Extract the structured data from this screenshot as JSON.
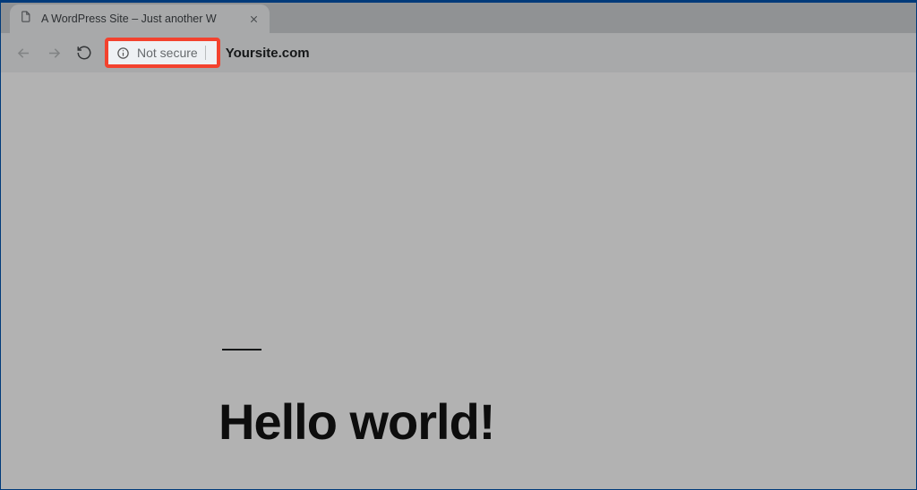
{
  "tab": {
    "title": "A WordPress Site – Just another W"
  },
  "toolbar": {
    "security_label": "Not secure",
    "url": "Yoursite.com"
  },
  "content": {
    "heading": "Hello world!"
  }
}
